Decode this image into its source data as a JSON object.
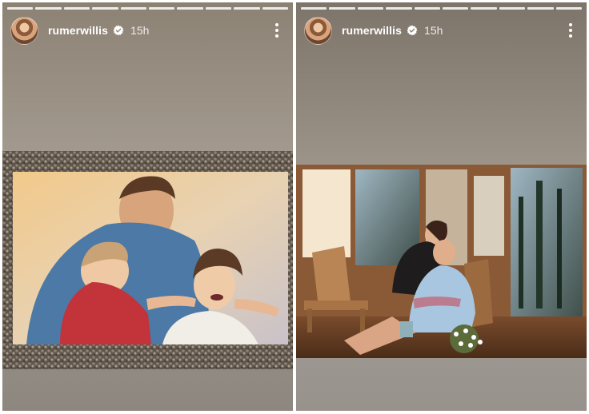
{
  "stories": [
    {
      "username": "rumerwillis",
      "timestamp": "15h",
      "verified": true,
      "progress_segments": 10,
      "avatar_icon": "profile-avatar",
      "more_icon": "more-vertical-icon",
      "media_description_icon": "story-photo"
    },
    {
      "username": "rumerwillis",
      "timestamp": "15h",
      "verified": true,
      "progress_segments": 10,
      "avatar_icon": "profile-avatar",
      "more_icon": "more-vertical-icon",
      "media_description_icon": "story-photo"
    }
  ],
  "colors": {
    "verified_badge": "#ffffff",
    "text": "#ffffff",
    "progress": "#ffffff"
  }
}
